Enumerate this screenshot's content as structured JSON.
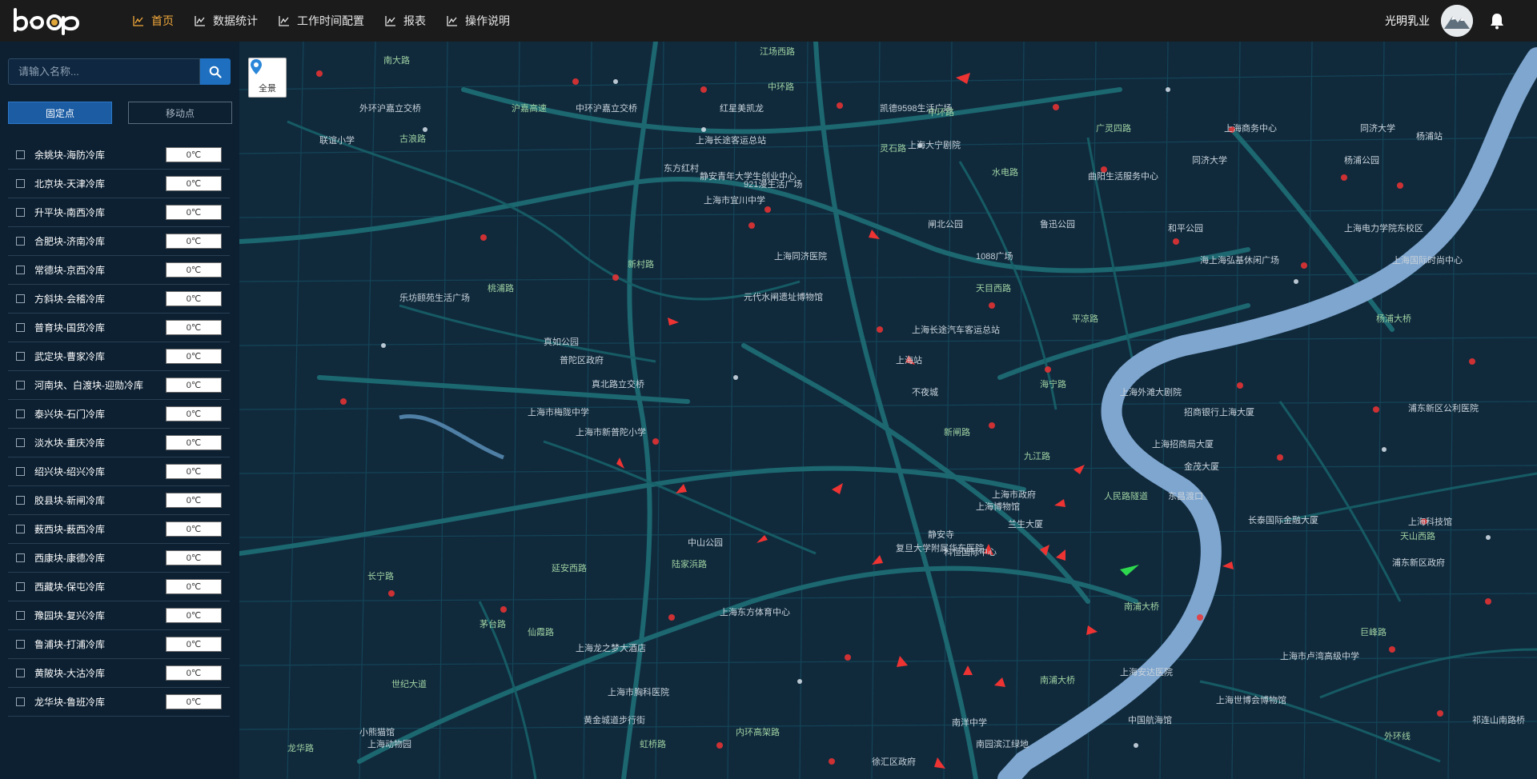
{
  "header": {
    "logo_text": "bxp",
    "nav": [
      {
        "label": "首页",
        "icon": "line-chart-icon",
        "active": true
      },
      {
        "label": "数据统计",
        "icon": "line-chart-icon",
        "active": false
      },
      {
        "label": "工作时间配置",
        "icon": "line-chart-icon",
        "active": false
      },
      {
        "label": "报表",
        "icon": "line-chart-icon",
        "active": false
      },
      {
        "label": "操作说明",
        "icon": "line-chart-icon",
        "active": false
      }
    ],
    "user_name": "光明乳业",
    "accent_color": "#f2a93b"
  },
  "sidebar": {
    "search_placeholder": "请输入名称...",
    "tabs": [
      "固定点",
      "移动点"
    ],
    "items": [
      {
        "name": "余姚块-海防冷库",
        "temp": "0℃"
      },
      {
        "name": "北京块-天津冷库",
        "temp": "0℃"
      },
      {
        "name": "升平块-南西冷库",
        "temp": "0℃"
      },
      {
        "name": "合肥块-济南冷库",
        "temp": "0℃"
      },
      {
        "name": "常德块-京西冷库",
        "temp": "0℃"
      },
      {
        "name": "方斜块-会稽冷库",
        "temp": "0℃"
      },
      {
        "name": "普育块-国货冷库",
        "temp": "0℃"
      },
      {
        "name": "武定块-曹家冷库",
        "temp": "0℃"
      },
      {
        "name": "河南块、白渡块-迎勋冷库",
        "temp": "0℃"
      },
      {
        "name": "泰兴块-石门冷库",
        "temp": "0℃"
      },
      {
        "name": "淡水块-重庆冷库",
        "temp": "0℃"
      },
      {
        "name": "绍兴块-绍兴冷库",
        "temp": "0℃"
      },
      {
        "name": "胶县块-新闸冷库",
        "temp": "0℃"
      },
      {
        "name": "薮西块-薮西冷库",
        "temp": "0℃"
      },
      {
        "name": "西康块-康德冷库",
        "temp": "0℃"
      },
      {
        "name": "西藏块-保屯冷库",
        "temp": "0℃"
      },
      {
        "name": "豫园块-复兴冷库",
        "temp": "0℃"
      },
      {
        "name": "鲁浦块-打浦冷库",
        "temp": "0℃"
      },
      {
        "name": "黄陂块-大沽冷库",
        "temp": "0℃"
      },
      {
        "name": "龙华块-鲁班冷库",
        "temp": "0℃"
      }
    ]
  },
  "map": {
    "overview_label": "全景",
    "labels": [
      {
        "text": "南大路",
        "kind": "road"
      },
      {
        "text": "江场西路",
        "kind": "road"
      },
      {
        "text": "中环路",
        "kind": "road"
      },
      {
        "text": "外环沪嘉立交桥",
        "kind": "poi"
      },
      {
        "text": "沪嘉高速",
        "kind": "road"
      },
      {
        "text": "中环沪嘉立交桥",
        "kind": "poi"
      },
      {
        "text": "古浪路",
        "kind": "road"
      },
      {
        "text": "联谊小学",
        "kind": "poi"
      },
      {
        "text": "上海长途客运总站",
        "kind": "poi"
      },
      {
        "text": "红星美凯龙",
        "kind": "poi"
      },
      {
        "text": "凯德9598生活广场",
        "kind": "poi"
      },
      {
        "text": "中环路",
        "kind": "road"
      },
      {
        "text": "广灵四路",
        "kind": "road"
      },
      {
        "text": "上海商务中心",
        "kind": "poi"
      },
      {
        "text": "同济大学",
        "kind": "poi"
      },
      {
        "text": "杨浦站",
        "kind": "poi"
      },
      {
        "text": "东方红村",
        "kind": "poi"
      },
      {
        "text": "静安青年大学生创业中心",
        "kind": "poi"
      },
      {
        "text": "灵石路",
        "kind": "road"
      },
      {
        "text": "上海大宁剧院",
        "kind": "poi"
      },
      {
        "text": "水电路",
        "kind": "road"
      },
      {
        "text": "曲阳生活服务中心",
        "kind": "poi"
      },
      {
        "text": "同济大学",
        "kind": "poi"
      },
      {
        "text": "杨浦公园",
        "kind": "poi"
      },
      {
        "text": "921漫生活广场",
        "kind": "poi"
      },
      {
        "text": "上海市宜川中学",
        "kind": "poi"
      },
      {
        "text": "闸北公园",
        "kind": "poi"
      },
      {
        "text": "鲁迅公园",
        "kind": "poi"
      },
      {
        "text": "和平公园",
        "kind": "poi"
      },
      {
        "text": "上海电力学院东校区",
        "kind": "poi"
      },
      {
        "text": "上海同济医院",
        "kind": "poi"
      },
      {
        "text": "1088广场",
        "kind": "poi"
      },
      {
        "text": "海上海弘基休闲广场",
        "kind": "poi"
      },
      {
        "text": "上海国际时尚中心",
        "kind": "poi"
      },
      {
        "text": "新村路",
        "kind": "road"
      },
      {
        "text": "桃浦路",
        "kind": "road"
      },
      {
        "text": "乐坊颐苑生活广场",
        "kind": "poi"
      },
      {
        "text": "元代水闸遗址博物馆",
        "kind": "poi"
      },
      {
        "text": "天目西路",
        "kind": "road"
      },
      {
        "text": "平凉路",
        "kind": "road"
      },
      {
        "text": "杨浦大桥",
        "kind": "road"
      },
      {
        "text": "上海长途汽车客运总站",
        "kind": "poi"
      },
      {
        "text": "上海站",
        "kind": "poi"
      },
      {
        "text": "普陀区政府",
        "kind": "poi"
      },
      {
        "text": "真如公园",
        "kind": "poi"
      },
      {
        "text": "真北路立交桥",
        "kind": "poi"
      },
      {
        "text": "不夜城",
        "kind": "poi"
      },
      {
        "text": "海宁路",
        "kind": "road"
      },
      {
        "text": "上海外滩大剧院",
        "kind": "poi"
      },
      {
        "text": "招商银行上海大厦",
        "kind": "poi"
      },
      {
        "text": "浦东新区公利医院",
        "kind": "poi"
      },
      {
        "text": "上海市梅陇中学",
        "kind": "poi"
      },
      {
        "text": "上海市新普陀小学",
        "kind": "poi"
      },
      {
        "text": "新闸路",
        "kind": "road"
      },
      {
        "text": "九江路",
        "kind": "road"
      },
      {
        "text": "上海招商局大厦",
        "kind": "poi"
      },
      {
        "text": "金茂大厦",
        "kind": "poi"
      },
      {
        "text": "上海市政府",
        "kind": "poi"
      },
      {
        "text": "上海博物馆",
        "kind": "poi"
      },
      {
        "text": "人民路隧道",
        "kind": "road"
      },
      {
        "text": "东昌渡口",
        "kind": "poi"
      },
      {
        "text": "中山公园",
        "kind": "poi"
      },
      {
        "text": "静安寺",
        "kind": "poi"
      },
      {
        "text": "科恒国际中心",
        "kind": "poi"
      },
      {
        "text": "复旦大学附属华东医院",
        "kind": "poi"
      },
      {
        "text": "兰生大厦",
        "kind": "poi"
      },
      {
        "text": "长泰国际金融大厦",
        "kind": "poi"
      },
      {
        "text": "上海科技馆",
        "kind": "poi"
      },
      {
        "text": "浦东新区政府",
        "kind": "poi"
      },
      {
        "text": "天山西路",
        "kind": "road"
      },
      {
        "text": "长宁路",
        "kind": "road"
      },
      {
        "text": "延安西路",
        "kind": "road"
      },
      {
        "text": "陆家浜路",
        "kind": "road"
      },
      {
        "text": "南浦大桥",
        "kind": "road"
      },
      {
        "text": "茅台路",
        "kind": "road"
      },
      {
        "text": "仙霞路",
        "kind": "road"
      },
      {
        "text": "上海龙之梦大酒店",
        "kind": "poi"
      },
      {
        "text": "上海东方体育中心",
        "kind": "poi"
      },
      {
        "text": "上海市卢湾高级中学",
        "kind": "poi"
      },
      {
        "text": "南浦大桥",
        "kind": "road"
      },
      {
        "text": "上海世博会博物馆",
        "kind": "poi"
      },
      {
        "text": "世纪大道",
        "kind": "road"
      },
      {
        "text": "上海市胸科医院",
        "kind": "poi"
      },
      {
        "text": "黄金城道步行街",
        "kind": "poi"
      },
      {
        "text": "南洋中学",
        "kind": "poi"
      },
      {
        "text": "南园滨江绿地",
        "kind": "poi"
      },
      {
        "text": "中国航海馆",
        "kind": "poi"
      },
      {
        "text": "徐汇区政府",
        "kind": "poi"
      },
      {
        "text": "龙华路",
        "kind": "road"
      },
      {
        "text": "上海动物园",
        "kind": "poi"
      },
      {
        "text": "小熊猫馆",
        "kind": "poi"
      },
      {
        "text": "虹桥路",
        "kind": "road"
      },
      {
        "text": "内环高架路",
        "kind": "road"
      },
      {
        "text": "上海安达医院",
        "kind": "poi"
      },
      {
        "text": "巨峰路",
        "kind": "road"
      },
      {
        "text": "外环线",
        "kind": "road"
      },
      {
        "text": "祁连山南路桥",
        "kind": "poi"
      }
    ]
  }
}
